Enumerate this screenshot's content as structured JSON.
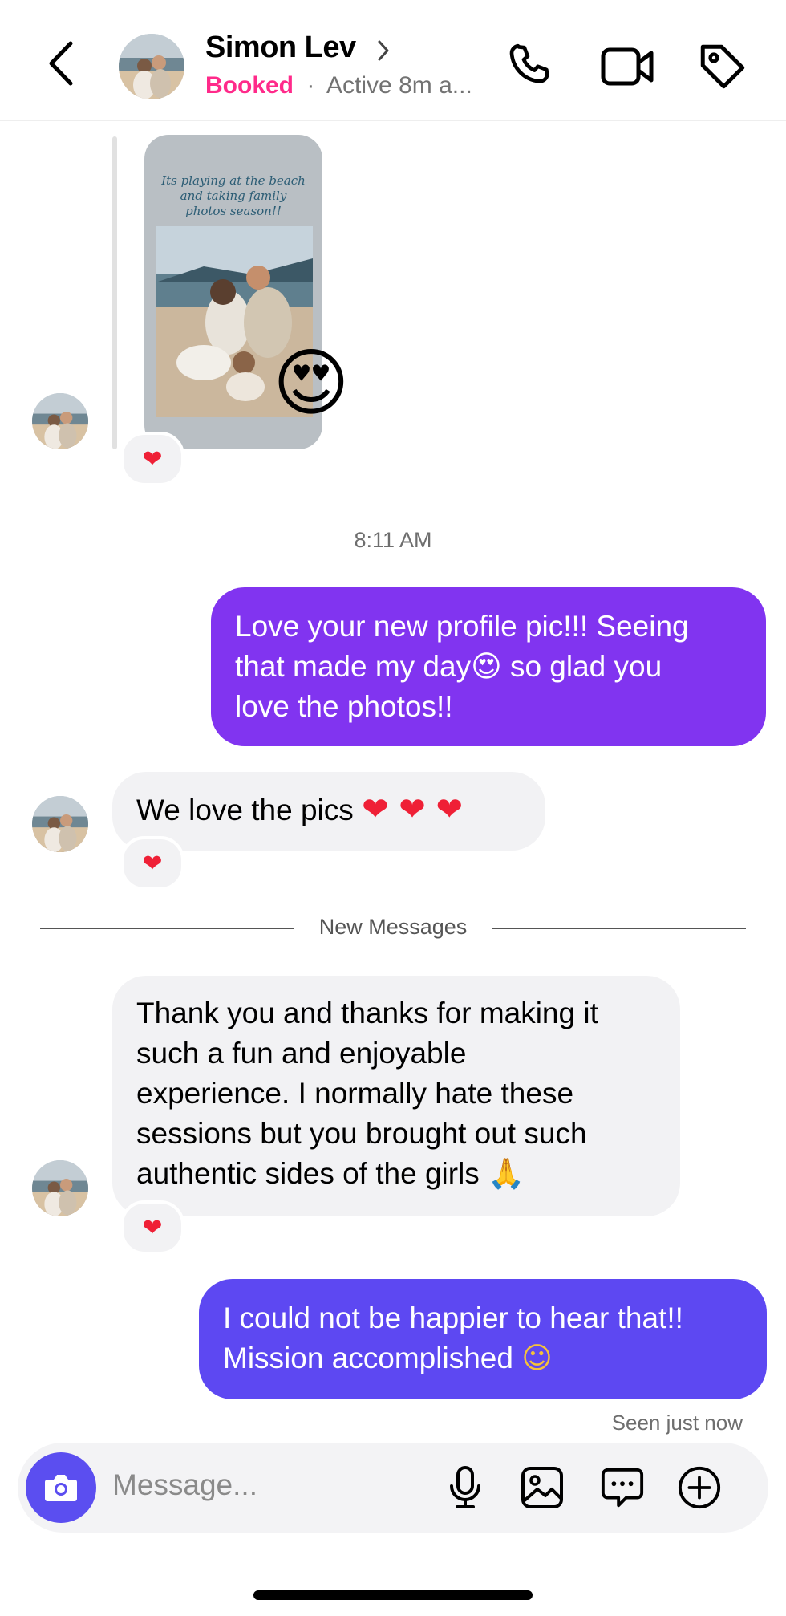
{
  "header": {
    "name": "Simon Lev",
    "status_booked": "Booked",
    "status_separator": "·",
    "status_active": "Active 8m a...",
    "icons": [
      "back-chevron-icon",
      "phone-icon",
      "video-icon",
      "tag-icon"
    ]
  },
  "story": {
    "caption": "Its playing at the beach and taking family photos season!!",
    "overlay_emoji": "😍",
    "reaction": "❤"
  },
  "timestamp": "8:11 AM",
  "messages": {
    "out1": {
      "line1": "Love your new profile pic!!! Seeing",
      "line2a": "that made my day",
      "line2_emoji": "😍",
      "line2b": " so glad you",
      "line3": "love the photos!!",
      "color": "#8134f0"
    },
    "in1": {
      "text": "We love the pics ",
      "hearts": "❤ ❤ ❤",
      "reaction": "❤"
    },
    "divider_label": "New Messages",
    "in2": {
      "line1": "Thank you and thanks for making it",
      "line2": "such a fun and enjoyable",
      "line3": "experience. I normally hate these",
      "line4": "sessions but you brought out such",
      "line5": "authentic sides of the girls ",
      "emoji": "🙏",
      "reaction": "❤"
    },
    "out2": {
      "line1": "I could not be happier to hear that!!",
      "line2": "Mission accomplished ",
      "emoji": "☺",
      "color": "#5d48f2"
    },
    "seen": "Seen just now"
  },
  "composer": {
    "placeholder": "Message...",
    "icons": [
      "camera-icon",
      "microphone-icon",
      "gallery-icon",
      "message-options-icon",
      "add-icon"
    ]
  },
  "colors": {
    "accent": "#5b4ef0",
    "booked": "#ff2a8a",
    "heart": "#ef2036",
    "incoming_bg": "#f2f2f4"
  }
}
